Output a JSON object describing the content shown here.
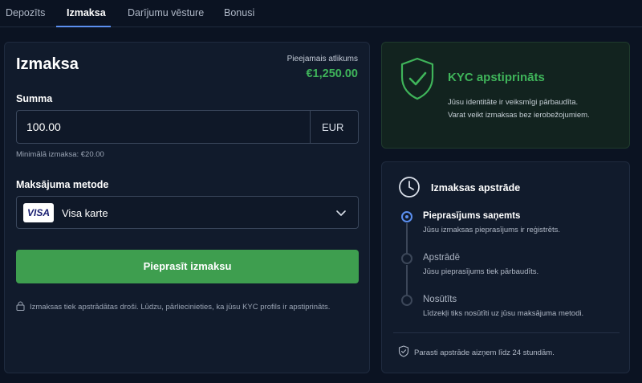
{
  "tabs": [
    {
      "label": "Depozīts"
    },
    {
      "label": "Izmaksa"
    },
    {
      "label": "Darījumu vēsture"
    },
    {
      "label": "Bonusi"
    }
  ],
  "active_tab": "Izmaksa",
  "withdraw": {
    "title": "Izmaksa",
    "balance_label": "Pieejamais atlikums",
    "balance_value": "€1,250.00",
    "amount_label": "Summa",
    "amount_value": "100.00",
    "currency": "EUR",
    "min_note": "Minimālā izmaksa: €20.00",
    "method_label": "Maksājuma metode",
    "method_badge": "VISA",
    "method_value": "Visa karte",
    "submit_label": "Pieprasīt izmaksu",
    "secure_note": "Izmaksas tiek apstrādātas droši. Lūdzu, pārliecinieties, ka jūsu KYC profils ir apstiprināts."
  },
  "kyc": {
    "title": "KYC apstiprināts",
    "line1": "Jūsu identitāte ir veiksmīgi pārbaudīta.",
    "line2": "Varat veikt izmaksas bez ierobežojumiem."
  },
  "processing": {
    "title": "Izmaksas apstrāde",
    "steps": [
      {
        "title": "Pieprasījums saņemts",
        "desc": "Jūsu izmaksas pieprasījums ir reģistrēts.",
        "state": "active"
      },
      {
        "title": "Apstrādē",
        "desc": "Jūsu pieprasījums tiek pārbaudīts.",
        "state": "pending"
      },
      {
        "title": "Nosūtīts",
        "desc": "Līdzekļi tiks nosūtīti uz jūsu maksājuma metodi.",
        "state": "pending"
      }
    ],
    "note": "Parasti apstrāde aizņem līdz 24 stundām."
  },
  "colors": {
    "accent_blue": "#5b8ff0",
    "success_green": "#3fb45a",
    "button_green": "#3e9e4f",
    "background": "#0b1322"
  }
}
